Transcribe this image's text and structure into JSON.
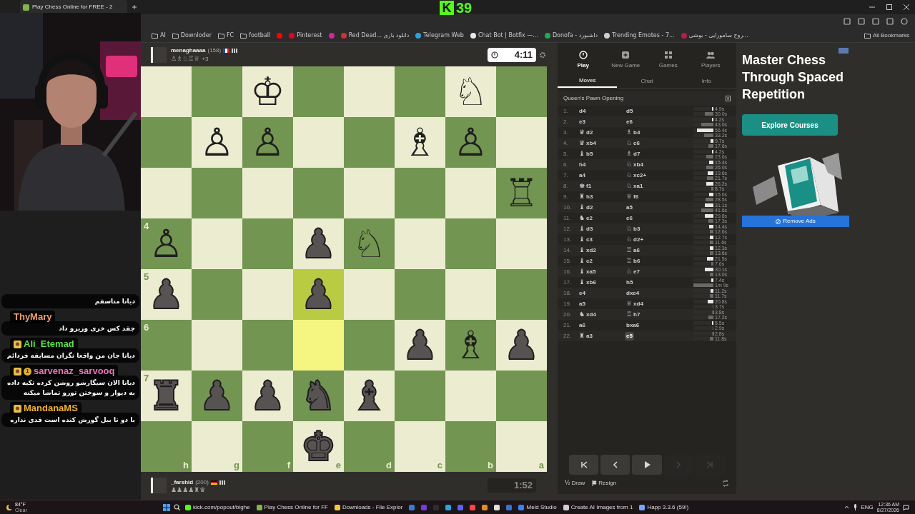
{
  "browser": {
    "tab_title": "Play Chess Online for FREE - 2",
    "bookmarks": [
      {
        "kind": "folder",
        "label": "AI"
      },
      {
        "kind": "folder",
        "label": "Downloder"
      },
      {
        "kind": "folder",
        "label": "FC"
      },
      {
        "kind": "folder",
        "label": "football"
      },
      {
        "kind": "site",
        "color": "#ff0000"
      },
      {
        "kind": "site",
        "color": "#e60023",
        "label": "Pinterest"
      },
      {
        "kind": "site",
        "color": "#d6249f"
      },
      {
        "kind": "site",
        "color": "#cc3333",
        "label": "Red Dead... دانلود بازی"
      },
      {
        "kind": "site",
        "color": "#2aa3e0",
        "label": "Telegram Web"
      },
      {
        "kind": "site",
        "color": "#e8e8e8",
        "label": "Chat Bot | Botfix —..."
      },
      {
        "kind": "site",
        "color": "#22aa55",
        "label": "Donofa - داشبورد"
      },
      {
        "kind": "site",
        "color": "#d0d0d0",
        "label": "Trending Emotes - 7..."
      },
      {
        "kind": "site",
        "color": "#b0204a",
        "label": "روح سامورایی - بوشی..."
      }
    ],
    "all_bookmarks": "All Bookmarks"
  },
  "stream_overlay": {
    "logo": "K",
    "viewers": "39"
  },
  "top_player": {
    "name": "menaghaaaa",
    "rating": "(158)",
    "captured": "♙♗♘♖♕",
    "advantage": "+3",
    "clock": "4:11",
    "clock_active": true
  },
  "bottom_player": {
    "name": "_farshid",
    "rating": "(200)",
    "captured": "♟♟♟♟♜♛",
    "clock": "1:52",
    "clock_active": false
  },
  "board": {
    "file_labels": [
      "h",
      "g",
      "f",
      "e",
      "d",
      "c",
      "b",
      "a"
    ],
    "rows": [
      {
        "cells": [
          {
            "highlighted": false
          },
          {
            "highlighted": false
          },
          {
            "highlighted": false,
            "piece": "♔",
            "white": true
          },
          {
            "highlighted": false
          },
          {
            "highlighted": false
          },
          {
            "highlighted": false
          },
          {
            "highlighted": false,
            "piece": "♘",
            "white": true
          },
          {
            "highlighted": false
          }
        ]
      },
      {
        "cells": [
          {
            "highlighted": false
          },
          {
            "highlighted": false,
            "piece": "♙",
            "white": true
          },
          {
            "highlighted": false,
            "piece": "♙",
            "white": true
          },
          {
            "highlighted": false
          },
          {
            "highlighted": false
          },
          {
            "highlighted": false,
            "piece": "♗",
            "white": true
          },
          {
            "highlighted": false,
            "piece": "♙",
            "white": true
          },
          {
            "highlighted": false
          }
        ]
      },
      {
        "cells": [
          {
            "highlighted": false
          },
          {
            "highlighted": false
          },
          {
            "highlighted": false
          },
          {
            "highlighted": false
          },
          {
            "highlighted": false
          },
          {
            "highlighted": false
          },
          {
            "highlighted": false
          },
          {
            "highlighted": false,
            "piece": "♖",
            "white": true
          }
        ]
      },
      {
        "rank_label": "4",
        "cells": [
          {
            "highlighted": false,
            "piece": "♙",
            "white": true
          },
          {
            "highlighted": false
          },
          {
            "highlighted": false
          },
          {
            "highlighted": false,
            "piece": "♟",
            "white": false
          },
          {
            "highlighted": false,
            "piece": "♘",
            "white": true
          },
          {
            "highlighted": false
          },
          {
            "highlighted": false
          },
          {
            "highlighted": false
          }
        ]
      },
      {
        "rank_label": "5",
        "cells": [
          {
            "highlighted": false,
            "piece": "♟",
            "white": false
          },
          {
            "highlighted": false
          },
          {
            "highlighted": false
          },
          {
            "highlighted": true,
            "piece": "♟",
            "white": false
          },
          {
            "highlighted": false
          },
          {
            "highlighted": false
          },
          {
            "highlighted": false
          },
          {
            "highlighted": false
          }
        ]
      },
      {
        "rank_label": "6",
        "cells": [
          {
            "highlighted": false
          },
          {
            "highlighted": false
          },
          {
            "highlighted": false
          },
          {
            "highlighted": true
          },
          {
            "highlighted": false
          },
          {
            "highlighted": false,
            "piece": "♟",
            "white": false
          },
          {
            "highlighted": false,
            "piece": "♗",
            "white": true
          },
          {
            "highlighted": false,
            "piece": "♟",
            "white": false
          }
        ]
      },
      {
        "rank_label": "7",
        "cells": [
          {
            "highlighted": false,
            "piece": "♜",
            "white": false
          },
          {
            "highlighted": false,
            "piece": "♟",
            "white": false
          },
          {
            "highlighted": false,
            "piece": "♟",
            "white": false
          },
          {
            "highlighted": false,
            "piece": "♞",
            "white": false
          },
          {
            "highlighted": false,
            "piece": "♝",
            "white": false
          },
          {
            "highlighted": false
          },
          {
            "highlighted": false
          },
          {
            "highlighted": false
          }
        ]
      },
      {
        "cells": [
          {
            "highlighted": false
          },
          {
            "highlighted": false
          },
          {
            "highlighted": false
          },
          {
            "highlighted": false,
            "piece": "♚",
            "white": false
          },
          {
            "highlighted": false
          },
          {
            "highlighted": false
          },
          {
            "highlighted": false
          },
          {
            "highlighted": false
          }
        ]
      }
    ]
  },
  "panel": {
    "nav": [
      {
        "label": "Play",
        "selected": true
      },
      {
        "label": "New Game",
        "selected": false
      },
      {
        "label": "Games",
        "selected": false
      },
      {
        "label": "Players",
        "selected": false
      }
    ],
    "tabs": [
      {
        "label": "Moves",
        "selected": true
      },
      {
        "label": "Chat",
        "selected": false
      },
      {
        "label": "Info",
        "selected": false
      }
    ],
    "opening": "Queen's Pawn Opening",
    "moves": [
      {
        "n": "1.",
        "white": {
          "san": "d4",
          "selected": false
        },
        "black": {
          "san": "d5",
          "selected": false
        },
        "white_time": {
          "text": "4.9s",
          "level": 0.07
        },
        "black_time": {
          "text": "30.0s",
          "level": 0.43
        }
      },
      {
        "n": "2.",
        "white": {
          "san": "e3",
          "selected": false
        },
        "black": {
          "san": "e6",
          "selected": false
        },
        "white_time": {
          "text": "4.2s",
          "level": 0.06
        },
        "black_time": {
          "text": "43.0s",
          "level": 0.61
        }
      },
      {
        "n": "3.",
        "white": {
          "piece": "♛",
          "san": "d2",
          "selected": false
        },
        "black": {
          "piece": "♗",
          "san": "b4",
          "selected": false
        },
        "white_time": {
          "text": "56.4s",
          "level": 0.81
        },
        "black_time": {
          "text": "33.2s",
          "level": 0.47
        }
      },
      {
        "n": "4.",
        "white": {
          "piece": "♛",
          "san": "xb4",
          "selected": false
        },
        "black": {
          "piece": "♘",
          "san": "c6",
          "selected": false
        },
        "white_time": {
          "text": "9.7s",
          "level": 0.14
        },
        "black_time": {
          "text": "17.6s",
          "level": 0.25
        }
      },
      {
        "n": "5.",
        "white": {
          "piece": "♝",
          "san": "b5",
          "selected": false
        },
        "black": {
          "piece": "♗",
          "san": "d7",
          "selected": false
        },
        "white_time": {
          "text": "4.2s",
          "level": 0.06
        },
        "black_time": {
          "text": "23.6s",
          "level": 0.34
        }
      },
      {
        "n": "6.",
        "white": {
          "san": "h4",
          "selected": false
        },
        "black": {
          "piece": "♘",
          "san": "xb4",
          "selected": false
        },
        "white_time": {
          "text": "15.4s",
          "level": 0.22
        },
        "black_time": {
          "text": "26.0s",
          "level": 0.37
        }
      },
      {
        "n": "7.",
        "white": {
          "san": "a4",
          "selected": false
        },
        "black": {
          "piece": "♘",
          "san": "xc2+",
          "selected": false
        },
        "white_time": {
          "text": "19.6s",
          "level": 0.28
        },
        "black_time": {
          "text": "21.7s",
          "level": 0.31
        }
      },
      {
        "n": "8.",
        "white": {
          "piece": "♚",
          "san": "f1",
          "selected": false
        },
        "black": {
          "piece": "♘",
          "san": "xa1",
          "selected": false
        },
        "white_time": {
          "text": "26.2s",
          "level": 0.37
        },
        "black_time": {
          "text": "8.7s",
          "level": 0.12
        }
      },
      {
        "n": "9.",
        "white": {
          "piece": "♜",
          "san": "h3",
          "selected": false
        },
        "black": {
          "piece": "♕",
          "san": "f6",
          "selected": false
        },
        "white_time": {
          "text": "15.0s",
          "level": 0.21
        },
        "black_time": {
          "text": "28.5s",
          "level": 0.41
        }
      },
      {
        "n": "10.",
        "white": {
          "piece": "♝",
          "san": "d2",
          "selected": false
        },
        "black": {
          "san": "a5",
          "selected": false
        },
        "white_time": {
          "text": "31.1s",
          "level": 0.44
        },
        "black_time": {
          "text": "41.6s",
          "level": 0.59
        }
      },
      {
        "n": "11.",
        "white": {
          "piece": "♞",
          "san": "e2",
          "selected": false
        },
        "black": {
          "san": "c6",
          "selected": false
        },
        "white_time": {
          "text": "29.8s",
          "level": 0.43
        },
        "black_time": {
          "text": "17.3s",
          "level": 0.25
        }
      },
      {
        "n": "12.",
        "white": {
          "piece": "♝",
          "san": "d3",
          "selected": false
        },
        "black": {
          "piece": "♘",
          "san": "b3",
          "selected": false
        },
        "white_time": {
          "text": "14.4s",
          "level": 0.21
        },
        "black_time": {
          "text": "12.6s",
          "level": 0.18
        }
      },
      {
        "n": "13.",
        "white": {
          "piece": "♝",
          "san": "c3",
          "selected": false
        },
        "black": {
          "piece": "♘",
          "san": "d2+",
          "selected": false
        },
        "white_time": {
          "text": "12.7s",
          "level": 0.18
        },
        "black_time": {
          "text": "11.6s",
          "level": 0.17
        }
      },
      {
        "n": "14.",
        "white": {
          "piece": "♝",
          "san": "xd2",
          "selected": false
        },
        "black": {
          "piece": "♖",
          "san": "a6",
          "selected": false
        },
        "white_time": {
          "text": "12.3s",
          "level": 0.18
        },
        "black_time": {
          "text": "13.6s",
          "level": 0.19
        }
      },
      {
        "n": "15.",
        "white": {
          "piece": "♝",
          "san": "c2",
          "selected": false
        },
        "black": {
          "piece": "♖",
          "san": "b6",
          "selected": false
        },
        "white_time": {
          "text": "21.5s",
          "level": 0.31
        },
        "black_time": {
          "text": "7.6s",
          "level": 0.11
        }
      },
      {
        "n": "16.",
        "white": {
          "piece": "♝",
          "san": "xa5",
          "selected": false
        },
        "black": {
          "piece": "♘",
          "san": "e7",
          "selected": false
        },
        "white_time": {
          "text": "30.1s",
          "level": 0.43
        },
        "black_time": {
          "text": "13.0s",
          "level": 0.19
        }
      },
      {
        "n": "17.",
        "white": {
          "piece": "♝",
          "san": "xb6",
          "selected": false
        },
        "black": {
          "san": "h5",
          "selected": false
        },
        "white_time": {
          "text": "7.4s",
          "level": 0.11
        },
        "black_time": {
          "text": "1m 9s",
          "level": 0.99
        }
      },
      {
        "n": "18.",
        "white": {
          "san": "e4",
          "selected": false
        },
        "black": {
          "san": "dxe4",
          "selected": false
        },
        "white_time": {
          "text": "11.2s",
          "level": 0.16
        },
        "black_time": {
          "text": "11.7s",
          "level": 0.17
        }
      },
      {
        "n": "19.",
        "white": {
          "san": "a5",
          "selected": false
        },
        "black": {
          "piece": "♕",
          "san": "xd4",
          "selected": false
        },
        "white_time": {
          "text": "20.8s",
          "level": 0.3
        },
        "black_time": {
          "text": "3.7s",
          "level": 0.05
        }
      },
      {
        "n": "20.",
        "white": {
          "piece": "♞",
          "san": "xd4",
          "selected": false
        },
        "black": {
          "piece": "♖",
          "san": "h7",
          "selected": false
        },
        "white_time": {
          "text": "3.8s",
          "level": 0.05
        },
        "black_time": {
          "text": "17.2s",
          "level": 0.25
        }
      },
      {
        "n": "21.",
        "white": {
          "san": "a6",
          "selected": false
        },
        "black": {
          "san": "bxa6",
          "selected": false
        },
        "white_time": {
          "text": "5.5s",
          "level": 0.08
        },
        "black_time": {
          "text": "2.9s",
          "level": 0.04
        }
      },
      {
        "n": "22.",
        "white": {
          "piece": "♜",
          "san": "a3",
          "selected": false
        },
        "black": {
          "san": "e5",
          "selected": true
        },
        "white_time": {
          "text": "2.8s",
          "level": 0.04
        },
        "black_time": {
          "text": "11.8s",
          "level": 0.17
        }
      }
    ],
    "nav_buttons": [
      {
        "kind": "first",
        "disabled": false
      },
      {
        "kind": "prev",
        "disabled": false
      },
      {
        "kind": "play",
        "disabled": false
      },
      {
        "kind": "next",
        "disabled": true
      },
      {
        "kind": "last",
        "disabled": true
      }
    ],
    "draw": {
      "symbol": "½",
      "label": "Draw"
    },
    "resign": "Resign"
  },
  "ad": {
    "headline": "Master Chess Through Spaced Repetition",
    "button": "Explore Courses",
    "remove_ads": "Remove Ads"
  },
  "chat": [
    {
      "text": "دیانا متاسفم"
    },
    {
      "user": "ThyMary",
      "color": "#f0a070",
      "text": "چقد کس خری وزیرو داد"
    },
    {
      "user": "Ali_Etemad",
      "color": "#5ee04a",
      "avatar": true,
      "text": "دیانا جان من واقعا نگران مسابقه فردائم"
    },
    {
      "user": "sarvenaz_sarvooq",
      "color": "#e676b8",
      "avatar": true,
      "sub_count": "1",
      "text": "دیانا الان سیگارشو روشن کرده تکیه داده به دیوار و سوختن تورو تماشا میکنه"
    },
    {
      "user": "MandanaMS",
      "color": "#f2b233",
      "avatar": true,
      "text": "با دو تا بیل گورش کنده است قدی نداره"
    }
  ],
  "taskbar": {
    "weather": {
      "temp": "84°F",
      "condition": "Clear"
    },
    "apps": [
      {
        "label": "kick.com/popout/bighe",
        "color": "#53fc18"
      },
      {
        "label": "Play Chess Online for FF",
        "color": "#81b64c"
      },
      {
        "label": "Downloads - File Explor",
        "color": "#f8c43c"
      },
      {
        "color": "#3a7bd5"
      },
      {
        "color": "#7a3ad5"
      },
      {
        "color": "#2d2d2d"
      },
      {
        "color": "#2aa3e0"
      },
      {
        "color": "#5865f2"
      },
      {
        "color": "#ff4444"
      },
      {
        "color": "#e58a2a"
      },
      {
        "color": "#e0e0e0"
      },
      {
        "color": "#3a6fd5"
      },
      {
        "label": "Meld Studio",
        "color": "#3b82f6"
      },
      {
        "label": "Create AI Images from 1",
        "color": "#d0d0d0"
      },
      {
        "label": "Happ 3.3.6 (59!)",
        "color": "#7aa2ff"
      }
    ],
    "language": "ENG",
    "time": "12:36 AM",
    "date": "8/27/2026"
  }
}
